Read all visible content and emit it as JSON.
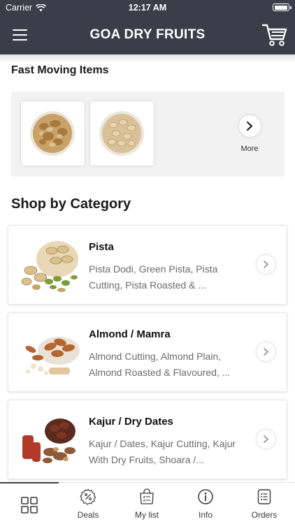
{
  "status_bar": {
    "carrier": "Carrier",
    "time": "12:17 AM"
  },
  "header": {
    "title": "GOA DRY FRUITS",
    "menu_icon": "hamburger-menu-icon",
    "cart_icon": "shopping-cart-icon"
  },
  "fast_moving": {
    "title": "Fast Moving Items",
    "items": [
      {
        "image": "walnut-bowl"
      },
      {
        "image": "pistachio-bowl"
      }
    ],
    "more_label": "More",
    "more_icon": "chevron-right-icon"
  },
  "categories": {
    "title": "Shop by Category",
    "items": [
      {
        "name": "Pista",
        "description": "Pista Dodi, Green Pista, Pista Cutting, Pista Roasted & ...",
        "image": "pistachio-pile"
      },
      {
        "name": "Almond / Mamra",
        "description": "Almond Cutting, Almond Plain, Almond Roasted & Flavoured, ...",
        "image": "almond-pile"
      },
      {
        "name": "Kajur / Dry Dates",
        "description": "Kajur / Dates, Kajur Cutting, Kajur With Dry Fruits, Shoara /...",
        "image": "dates-pile"
      }
    ]
  },
  "tab_bar": {
    "tabs": [
      {
        "label": "",
        "icon": "grid-icon",
        "active": true
      },
      {
        "label": "Deals",
        "icon": "badge-percent-icon",
        "active": false
      },
      {
        "label": "My list",
        "icon": "shopping-bag-list-icon",
        "active": false
      },
      {
        "label": "Info",
        "icon": "info-icon",
        "active": false
      },
      {
        "label": "Orders",
        "icon": "orders-list-icon",
        "active": false
      }
    ]
  },
  "colors": {
    "header": "#3a3e49",
    "panel": "#f2f2f2",
    "muted_text": "#6b6b6b"
  }
}
